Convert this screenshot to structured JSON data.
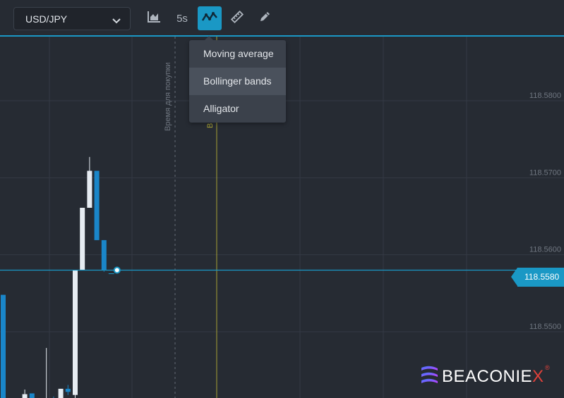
{
  "toolbar": {
    "pair": "USD/JPY",
    "timeframe": "5s",
    "accent_color": "#1a98c5"
  },
  "indicator_menu": {
    "items": [
      {
        "label": "Moving average"
      },
      {
        "label": "Bollinger bands"
      },
      {
        "label": "Alligator"
      }
    ],
    "highlighted": "Bollinger bands"
  },
  "chart": {
    "purchase_time_label": "Время для покупки",
    "expiration_label": "В",
    "current_price": "118.5580",
    "price_ticks": [
      "118.5800",
      "118.5700",
      "118.5600",
      "118.5500"
    ],
    "up_color": "#e6ecf2",
    "down_color": "#1a86c9"
  },
  "chart_data": {
    "type": "candlestick",
    "yaxis_ticks": [
      118.58,
      118.57,
      118.56,
      118.55
    ],
    "current_price": 118.558,
    "candles": [
      {
        "o": 118.5548,
        "c": 118.5398,
        "h": 118.5548,
        "l": 118.539,
        "dir": "down"
      },
      {
        "o": 118.54,
        "c": 118.5412,
        "h": 118.5413,
        "l": 118.539,
        "dir": "up"
      },
      {
        "o": 118.5412,
        "c": 118.54,
        "h": 118.5413,
        "l": 118.539,
        "dir": "down"
      },
      {
        "o": 118.54,
        "c": 118.5419,
        "h": 118.5425,
        "l": 118.539,
        "dir": "up"
      },
      {
        "o": 118.542,
        "c": 118.539,
        "h": 118.542,
        "l": 118.539,
        "dir": "down"
      },
      {
        "o": 118.5398,
        "c": 118.54,
        "h": 118.5405,
        "l": 118.539,
        "dir": "up"
      },
      {
        "o": 118.5398,
        "c": 118.5414,
        "h": 118.5479,
        "l": 118.539,
        "dir": "up"
      },
      {
        "o": 118.5414,
        "c": 118.54,
        "h": 118.5416,
        "l": 118.539,
        "dir": "down"
      },
      {
        "o": 118.54,
        "c": 118.5426,
        "h": 118.5426,
        "l": 118.539,
        "dir": "up"
      },
      {
        "o": 118.5426,
        "c": 118.5422,
        "h": 118.5431,
        "l": 118.5418,
        "dir": "down"
      },
      {
        "o": 118.5418,
        "c": 118.558,
        "h": 118.558,
        "l": 118.5408,
        "dir": "up"
      },
      {
        "o": 118.558,
        "c": 118.5661,
        "h": 118.5661,
        "l": 118.558,
        "dir": "up"
      },
      {
        "o": 118.5661,
        "c": 118.5709,
        "h": 118.5727,
        "l": 118.5661,
        "dir": "up"
      },
      {
        "o": 118.5709,
        "c": 118.5619,
        "h": 118.5709,
        "l": 118.5619,
        "dir": "down"
      },
      {
        "o": 118.5619,
        "c": 118.558,
        "h": 118.5619,
        "l": 118.5578,
        "dir": "down"
      }
    ]
  }
}
